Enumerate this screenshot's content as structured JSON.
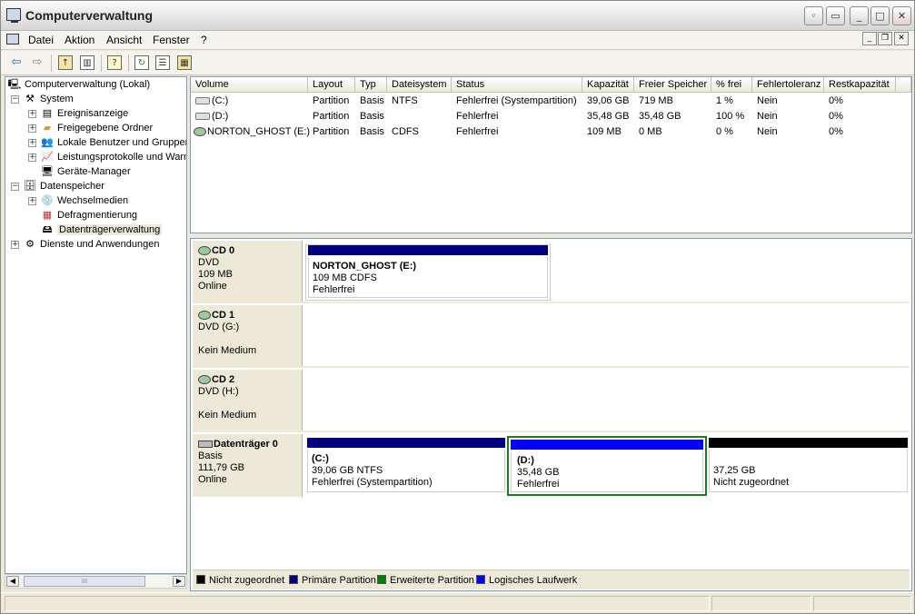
{
  "window": {
    "title": "Computerverwaltung",
    "icon": "computer-icon"
  },
  "menu": {
    "items": [
      "Datei",
      "Aktion",
      "Ansicht",
      "Fenster",
      "?"
    ]
  },
  "toolbar": {
    "icons": [
      "back-arrow-icon",
      "forward-arrow-icon",
      "up-folder-icon",
      "show-tree-icon",
      "help-icon",
      "refresh-icon",
      "properties-icon",
      "export-icon"
    ]
  },
  "tree": {
    "root": "Computerverwaltung (Lokal)",
    "system": "System",
    "ereignis": "Ereignisanzeige",
    "freigaben": "Freigegebene Ordner",
    "benutzer": "Lokale Benutzer und Gruppen",
    "leistung": "Leistungsprotokolle und Warnungen",
    "geraete": "Geräte-Manager",
    "datenspeicher": "Datenspeicher",
    "wechselmedien": "Wechselmedien",
    "defrag": "Defragmentierung",
    "datentraeger": "Datenträgerverwaltung",
    "dienste": "Dienste und Anwendungen"
  },
  "volume_table": {
    "headers": [
      "Volume",
      "Layout",
      "Typ",
      "Dateisystem",
      "Status",
      "Kapazität",
      "Freier Speicher",
      "% frei",
      "Fehlertoleranz",
      "Restkapazität"
    ],
    "rows": [
      [
        "(C:)",
        "Partition",
        "Basis",
        "NTFS",
        "Fehlerfrei (Systempartition)",
        "39,06 GB",
        "719 MB",
        "1 %",
        "Nein",
        "0%"
      ],
      [
        "(D:)",
        "Partition",
        "Basis",
        "",
        "Fehlerfrei",
        "35,48 GB",
        "35,48 GB",
        "100 %",
        "Nein",
        "0%"
      ],
      [
        "NORTON_GHOST (E:)",
        "Partition",
        "Basis",
        "CDFS",
        "Fehlerfrei",
        "109 MB",
        "0 MB",
        "0 %",
        "Nein",
        "0%"
      ]
    ]
  },
  "disks": {
    "cd0": {
      "name": "CD 0",
      "l1": "DVD",
      "l2": "109 MB",
      "l3": "Online",
      "part_name": "NORTON_GHOST  (E:)",
      "part_size": "109 MB CDFS",
      "part_status": "Fehlerfrei"
    },
    "cd1": {
      "name": "CD 1",
      "l1": "DVD (G:)",
      "l2": "Kein Medium"
    },
    "cd2": {
      "name": "CD 2",
      "l1": "DVD (H:)",
      "l2": "Kein Medium"
    },
    "disk0": {
      "name": "Datenträger 0",
      "l1": "Basis",
      "l2": "111,79 GB",
      "l3": "Online",
      "c_name": "(C:)",
      "c_size": "39,06 GB NTFS",
      "c_status": "Fehlerfrei (Systempartition)",
      "d_name": "(D:)",
      "d_size": "35,48 GB",
      "d_status": "Fehlerfrei",
      "u_size": "37,25 GB",
      "u_status": "Nicht zugeordnet"
    }
  },
  "legend": [
    "Nicht zugeordnet",
    "Primäre Partition",
    "Erweiterte Partition",
    "Logisches Laufwerk"
  ],
  "colors": {
    "unallocated": "#000000",
    "primary": "#000080",
    "extended": "#008000",
    "logical": "#0000ff"
  }
}
